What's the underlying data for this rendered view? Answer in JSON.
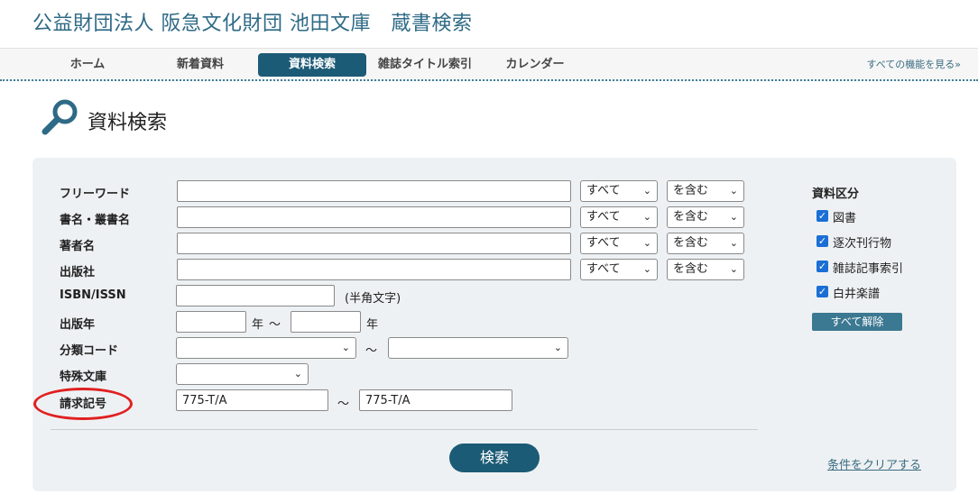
{
  "header": {
    "site_title": "公益財団法人 阪急文化財団 池田文庫　蔵書検索"
  },
  "nav": {
    "items": [
      {
        "label": "ホーム"
      },
      {
        "label": "新着資料"
      },
      {
        "label": "資料検索"
      },
      {
        "label": "雑誌タイトル索引"
      },
      {
        "label": "カレンダー"
      }
    ],
    "all_features": "すべての機能を見る»"
  },
  "page": {
    "title": "資料検索"
  },
  "form": {
    "rows": [
      {
        "label": "フリーワード",
        "value": "",
        "scope": "すべて",
        "match": "を含む"
      },
      {
        "label": "書名・叢書名",
        "value": "",
        "scope": "すべて",
        "match": "を含む"
      },
      {
        "label": "著者名",
        "value": "",
        "scope": "すべて",
        "match": "を含む"
      },
      {
        "label": "出版社",
        "value": "",
        "scope": "すべて",
        "match": "を含む"
      }
    ],
    "isbn": {
      "label": "ISBN/ISSN",
      "value": "",
      "note": "(半角文字)"
    },
    "year": {
      "label": "出版年",
      "from": "",
      "to": "",
      "unit": "年",
      "separator": "～"
    },
    "classification": {
      "label": "分類コード",
      "from": "",
      "to": "",
      "separator": "～"
    },
    "special": {
      "label": "特殊文庫",
      "value": ""
    },
    "call_number": {
      "label": "請求記号",
      "from": "775-T/A",
      "to": "775-T/A",
      "separator": "～"
    }
  },
  "material_type": {
    "title": "資料区分",
    "options": [
      {
        "label": "図書",
        "checked": true
      },
      {
        "label": "逐次刊行物",
        "checked": true
      },
      {
        "label": "雑誌記事索引",
        "checked": true
      },
      {
        "label": "白井楽譜",
        "checked": true
      }
    ],
    "clear_all": "すべて解除"
  },
  "actions": {
    "search": "検索",
    "clear_conditions": "条件をクリアする"
  },
  "colors": {
    "brand": "#1c5b76",
    "annotation": "#e02020"
  },
  "icons": {
    "search_heading": "magnifier-icon",
    "checkbox": "check-icon"
  }
}
